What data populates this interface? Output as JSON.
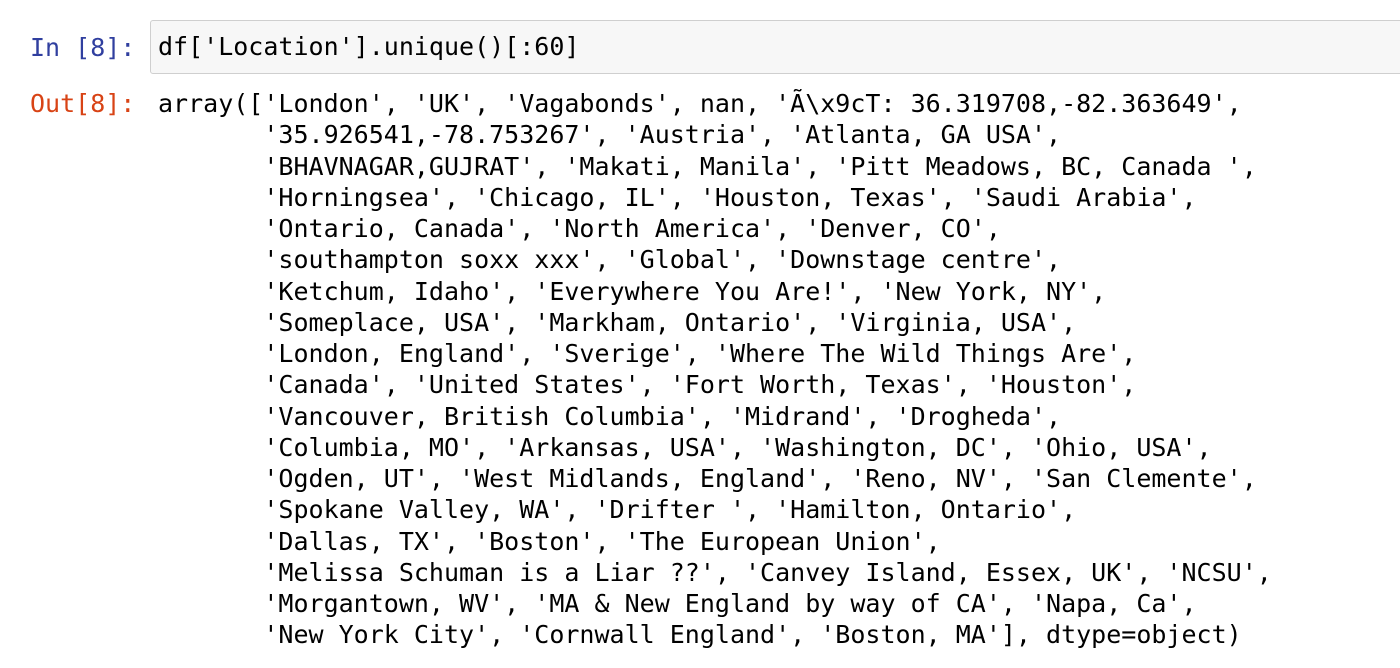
{
  "input_cell": {
    "prompt": "In [8]:",
    "code": "df['Location'].unique()[:60]"
  },
  "output_cell": {
    "prompt": "Out[8]:",
    "lines": [
      "array(['London', 'UK', 'Vagabonds', nan, 'Ã\\x9cT: 36.319708,-82.363649',",
      "       '35.926541,-78.753267', 'Austria', 'Atlanta, GA USA',",
      "       'BHAVNAGAR,GUJRAT', 'Makati, Manila', 'Pitt Meadows, BC, Canada ',",
      "       'Horningsea', 'Chicago, IL', 'Houston, Texas', 'Saudi Arabia',",
      "       'Ontario, Canada', 'North America', 'Denver, CO',",
      "       'southampton soxx xxx', 'Global', 'Downstage centre',",
      "       'Ketchum, Idaho', 'Everywhere You Are!', 'New York, NY',",
      "       'Someplace, USA', 'Markham, Ontario', 'Virginia, USA',",
      "       'London, England', 'Sverige', 'Where The Wild Things Are',",
      "       'Canada', 'United States', 'Fort Worth, Texas', 'Houston',",
      "       'Vancouver, British Columbia', 'Midrand', 'Drogheda',",
      "       'Columbia, MO', 'Arkansas, USA', 'Washington, DC', 'Ohio, USA',",
      "       'Ogden, UT', 'West Midlands, England', 'Reno, NV', 'San Clemente',",
      "       'Spokane Valley, WA', 'Drifter ', 'Hamilton, Ontario',",
      "       'Dallas, TX', 'Boston', 'The European Union',",
      "       'Melissa Schuman is a Liar ??', 'Canvey Island, Essex, UK', 'NCSU',",
      "       'Morgantown, WV', 'MA & New England by way of CA', 'Napa, Ca',",
      "       'New York City', 'Cornwall England', 'Boston, MA'], dtype=object)"
    ]
  }
}
